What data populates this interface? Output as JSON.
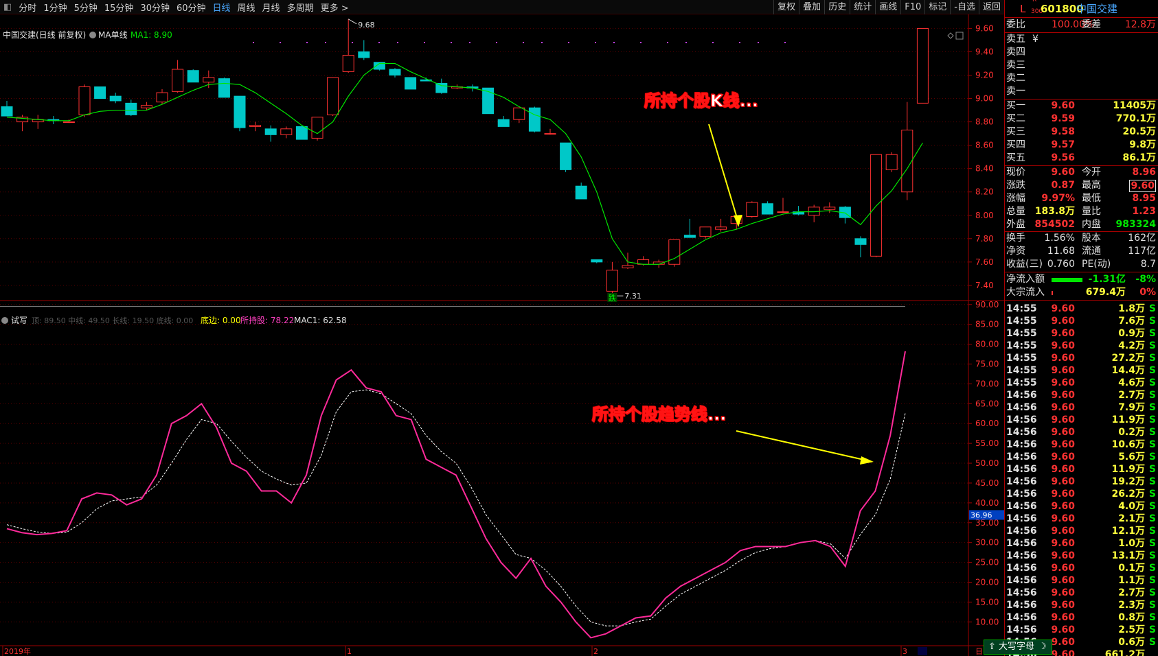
{
  "toolbar": {
    "items": [
      "分时",
      "1分钟",
      "5分钟",
      "15分钟",
      "30分钟",
      "60分钟",
      "日线",
      "周线",
      "月线",
      "多周期",
      "更多 >"
    ],
    "active_index": 6,
    "right_items": [
      "复权",
      "叠加",
      "历史",
      "统计",
      "画线",
      "F10",
      "标记",
      "-自选",
      "返回"
    ]
  },
  "stock_header": {
    "marker": "L",
    "code": "601800",
    "name": "中国交建",
    "sup": "R",
    "sub": "300"
  },
  "upper_chart": {
    "title": "中国交建(日线 前复权)",
    "indicator_label": "MA单线",
    "ma_label": "MA1: 8.90",
    "high_label": "9.68",
    "low_label": "7.31",
    "fall_tag": "跌",
    "annotation": "所持个股K线..."
  },
  "lower_chart": {
    "name": "试写",
    "legend_dim": "顶: 89.50  中线: 49.50  长线: 19.50  底线: 0.00",
    "legend_bottom": "底边: 0.00",
    "legend_pos": "所持股: 78.22",
    "legend_mac": "MAC1: 62.58",
    "annotation": "所持个股趋势线...",
    "current_tag": "36.96"
  },
  "date_axis": {
    "labels": [
      "2019年",
      "1",
      "2",
      "3"
    ],
    "right_label": "日"
  },
  "colors": {
    "up": "#ff3232",
    "down": "#00c8c8",
    "ma": "#00e600",
    "trend": "#ff2a9a",
    "mac": "#ffffff",
    "axis": "#a00000"
  },
  "chart_data": [
    {
      "type": "candlestick",
      "title": "中国交建(日线 前复权)",
      "y_ticks": [
        "9.60",
        "9.40",
        "9.20",
        "9.00",
        "8.80",
        "8.60",
        "8.40",
        "8.20",
        "8.00",
        "7.80",
        "7.60",
        "7.40"
      ],
      "ylim": [
        7.27,
        9.72
      ],
      "ohlc": [
        [
          8.93,
          8.98,
          8.85,
          8.85
        ],
        [
          8.8,
          8.86,
          8.72,
          8.84
        ],
        [
          8.8,
          8.86,
          8.74,
          8.82
        ],
        [
          8.82,
          8.85,
          8.78,
          8.81
        ],
        [
          8.8,
          8.82,
          8.79,
          8.8
        ],
        [
          8.86,
          9.12,
          8.84,
          9.1
        ],
        [
          9.1,
          9.1,
          9.0,
          9.0
        ],
        [
          9.02,
          9.05,
          8.96,
          8.98
        ],
        [
          8.96,
          8.99,
          8.85,
          8.86
        ],
        [
          8.92,
          8.97,
          8.9,
          8.94
        ],
        [
          8.97,
          9.08,
          8.95,
          9.05
        ],
        [
          9.06,
          9.33,
          9.05,
          9.25
        ],
        [
          9.24,
          9.25,
          9.14,
          9.14
        ],
        [
          9.14,
          9.24,
          9.09,
          9.18
        ],
        [
          9.17,
          9.18,
          9.01,
          9.01
        ],
        [
          9.02,
          9.02,
          8.72,
          8.75
        ],
        [
          8.76,
          8.8,
          8.72,
          8.77
        ],
        [
          8.74,
          8.77,
          8.63,
          8.69
        ],
        [
          8.69,
          8.76,
          8.66,
          8.74
        ],
        [
          8.76,
          8.76,
          8.65,
          8.65
        ],
        [
          8.66,
          8.84,
          8.64,
          8.84
        ],
        [
          8.86,
          9.18,
          8.85,
          9.18
        ],
        [
          9.23,
          9.68,
          9.22,
          9.37
        ],
        [
          9.4,
          9.5,
          9.33,
          9.35
        ],
        [
          9.31,
          9.31,
          9.24,
          9.25
        ],
        [
          9.25,
          9.26,
          9.18,
          9.2
        ],
        [
          9.18,
          9.18,
          9.08,
          9.08
        ],
        [
          9.16,
          9.18,
          9.15,
          9.15
        ],
        [
          9.13,
          9.17,
          9.04,
          9.05
        ],
        [
          9.09,
          9.12,
          9.08,
          9.1
        ],
        [
          9.1,
          9.12,
          9.06,
          9.09
        ],
        [
          9.09,
          9.09,
          8.87,
          8.87
        ],
        [
          8.82,
          8.85,
          8.77,
          8.76
        ],
        [
          8.82,
          8.92,
          8.79,
          8.92
        ],
        [
          8.92,
          8.93,
          8.71,
          8.72
        ],
        [
          8.7,
          8.74,
          8.69,
          8.7
        ],
        [
          8.62,
          8.62,
          8.37,
          8.39
        ],
        [
          8.25,
          8.28,
          8.16,
          8.14
        ],
        [
          7.62,
          7.62,
          7.59,
          7.6
        ],
        [
          7.35,
          7.6,
          7.31,
          7.53
        ],
        [
          7.55,
          7.68,
          7.54,
          7.57
        ],
        [
          7.58,
          7.65,
          7.57,
          7.62
        ],
        [
          7.58,
          7.62,
          7.55,
          7.6
        ],
        [
          7.58,
          7.75,
          7.56,
          7.79
        ],
        [
          7.83,
          7.97,
          7.83,
          7.81
        ],
        [
          7.82,
          7.88,
          7.8,
          7.9
        ],
        [
          7.88,
          7.97,
          7.86,
          7.9
        ],
        [
          7.93,
          7.96,
          7.88,
          7.99
        ],
        [
          7.99,
          8.12,
          7.98,
          8.11
        ],
        [
          8.1,
          8.12,
          8.03,
          8.01
        ],
        [
          8.03,
          8.15,
          8.02,
          8.03
        ],
        [
          8.03,
          8.08,
          8.0,
          8.01
        ],
        [
          8.0,
          8.09,
          7.94,
          8.07
        ],
        [
          8.05,
          8.11,
          8.02,
          8.07
        ],
        [
          8.07,
          8.08,
          7.93,
          7.98
        ],
        [
          7.8,
          7.82,
          7.64,
          7.75
        ],
        [
          7.65,
          8.52,
          7.64,
          8.52
        ],
        [
          8.39,
          8.54,
          8.37,
          8.52
        ],
        [
          8.2,
          8.97,
          8.13,
          8.73
        ],
        [
          8.96,
          9.6,
          8.96,
          9.6
        ]
      ],
      "ma": [
        8.84,
        8.83,
        8.82,
        8.81,
        8.81,
        8.86,
        8.89,
        8.9,
        8.9,
        8.9,
        8.95,
        9.01,
        9.07,
        9.12,
        9.13,
        9.12,
        9.05,
        8.96,
        8.87,
        8.77,
        8.7,
        8.8,
        9.02,
        9.2,
        9.3,
        9.3,
        9.23,
        9.17,
        9.11,
        9.1,
        9.09,
        9.06,
        9.01,
        8.93,
        8.86,
        8.82,
        8.7,
        8.5,
        8.2,
        7.8,
        7.6,
        7.58,
        7.58,
        7.63,
        7.71,
        7.79,
        7.85,
        7.88,
        7.93,
        7.97,
        8.01,
        8.03,
        8.03,
        8.04,
        8.02,
        7.92,
        8.08,
        8.21,
        8.4,
        8.62
      ]
    },
    {
      "type": "line",
      "y_ticks": [
        "90.00",
        "85.00",
        "80.00",
        "75.00",
        "70.00",
        "65.00",
        "60.00",
        "55.00",
        "50.00",
        "45.00",
        "40.00",
        "35.00",
        "30.00",
        "25.00",
        "20.00",
        "15.00",
        "10.00"
      ],
      "ylim": [
        4.0,
        91.0
      ],
      "series": [
        {
          "name": "所持股",
          "values": [
            33.5,
            32.5,
            32,
            32.3,
            33,
            41,
            42.5,
            42,
            39.5,
            41,
            47,
            60,
            62,
            65,
            59,
            50,
            48,
            43,
            43,
            40,
            47,
            62,
            71,
            73.5,
            69,
            68,
            62,
            61,
            51,
            49,
            47,
            39,
            31,
            25,
            21,
            26,
            19,
            15,
            10,
            6,
            7,
            9,
            11,
            11.5,
            16,
            19,
            21,
            23,
            25,
            28,
            29,
            29,
            29,
            30,
            30.5,
            29,
            24,
            38,
            43,
            57,
            78.22
          ]
        },
        {
          "name": "MAC1",
          "values": [
            34.5,
            33.5,
            32.7,
            32.3,
            32.6,
            35,
            38.5,
            40.5,
            41,
            41.5,
            44.5,
            50,
            56,
            61,
            60,
            55.5,
            51.5,
            48,
            46,
            44.5,
            45,
            52,
            63,
            68,
            68.5,
            67.5,
            65,
            62.5,
            57,
            53,
            50,
            44,
            37,
            32,
            27,
            26,
            23,
            19,
            14,
            10,
            9,
            9,
            10,
            10.7,
            14,
            17,
            19,
            21,
            23,
            25.5,
            27.5,
            28.5,
            29,
            30,
            30.5,
            29.7,
            26,
            32,
            37,
            46,
            62.58
          ]
        }
      ]
    }
  ],
  "side_panel": {
    "weibi": {
      "label": "委比",
      "value": "100.00%",
      "label2": "委差",
      "value2": "12.8万"
    },
    "sell": [
      {
        "label": "卖五",
        "price": "",
        "vol": "",
        "mark": "¥"
      },
      {
        "label": "卖四",
        "price": "",
        "vol": ""
      },
      {
        "label": "卖三",
        "price": "",
        "vol": ""
      },
      {
        "label": "卖二",
        "price": "",
        "vol": ""
      },
      {
        "label": "卖一",
        "price": "",
        "vol": ""
      }
    ],
    "buy": [
      {
        "label": "买一",
        "price": "9.60",
        "vol": "11405万"
      },
      {
        "label": "买二",
        "price": "9.59",
        "vol": "770.1万"
      },
      {
        "label": "买三",
        "price": "9.58",
        "vol": "20.5万"
      },
      {
        "label": "买四",
        "price": "9.57",
        "vol": "9.8万"
      },
      {
        "label": "买五",
        "price": "9.56",
        "vol": "86.1万"
      }
    ],
    "quote": [
      {
        "l1": "现价",
        "v1": "9.60",
        "l2": "今开",
        "v2": "8.96",
        "c1": "red",
        "c2": "red"
      },
      {
        "l1": "涨跌",
        "v1": "0.87",
        "l2": "最高",
        "v2": "9.60",
        "c1": "red",
        "c2": "red"
      },
      {
        "l1": "涨幅",
        "v1": "9.97%",
        "l2": "最低",
        "v2": "8.95",
        "c1": "red",
        "c2": "red"
      },
      {
        "l1": "总量",
        "v1": "183.8万",
        "l2": "量比",
        "v2": "1.23",
        "c1": "yellow",
        "c2": "red"
      },
      {
        "l1": "外盘",
        "v1": "854502",
        "l2": "内盘",
        "v2": "983324",
        "c1": "red",
        "c2": "green"
      }
    ],
    "stats": [
      {
        "l1": "换手",
        "v1": "1.56%",
        "l2": "股本",
        "v2": "162亿"
      },
      {
        "l1": "净资",
        "v1": "11.68",
        "l2": "流通",
        "v2": "117亿"
      },
      {
        "l1": "收益(三)",
        "v1": "0.760",
        "l2": "PE(动)",
        "v2": "8.7"
      }
    ],
    "flows": [
      {
        "label": "净流入额",
        "value": "-1.31亿",
        "pct": "-8%"
      },
      {
        "label": "大宗流入",
        "value": "679.4万",
        "pct": "0%"
      }
    ],
    "ticks": [
      {
        "t": "14:55",
        "p": "9.60",
        "v": "1.8万",
        "s": "S"
      },
      {
        "t": "14:55",
        "p": "9.60",
        "v": "7.6万",
        "s": "S"
      },
      {
        "t": "14:55",
        "p": "9.60",
        "v": "0.9万",
        "s": "S"
      },
      {
        "t": "14:55",
        "p": "9.60",
        "v": "4.2万",
        "s": "S"
      },
      {
        "t": "14:55",
        "p": "9.60",
        "v": "27.2万",
        "s": "S"
      },
      {
        "t": "14:55",
        "p": "9.60",
        "v": "14.4万",
        "s": "S"
      },
      {
        "t": "14:55",
        "p": "9.60",
        "v": "4.6万",
        "s": "S"
      },
      {
        "t": "14:56",
        "p": "9.60",
        "v": "2.7万",
        "s": "S"
      },
      {
        "t": "14:56",
        "p": "9.60",
        "v": "7.9万",
        "s": "S"
      },
      {
        "t": "14:56",
        "p": "9.60",
        "v": "11.9万",
        "s": "S"
      },
      {
        "t": "14:56",
        "p": "9.60",
        "v": "0.2万",
        "s": "S"
      },
      {
        "t": "14:56",
        "p": "9.60",
        "v": "10.6万",
        "s": "S"
      },
      {
        "t": "14:56",
        "p": "9.60",
        "v": "5.6万",
        "s": "S"
      },
      {
        "t": "14:56",
        "p": "9.60",
        "v": "11.9万",
        "s": "S"
      },
      {
        "t": "14:56",
        "p": "9.60",
        "v": "19.2万",
        "s": "S"
      },
      {
        "t": "14:56",
        "p": "9.60",
        "v": "26.2万",
        "s": "S"
      },
      {
        "t": "14:56",
        "p": "9.60",
        "v": "4.0万",
        "s": "S"
      },
      {
        "t": "14:56",
        "p": "9.60",
        "v": "2.1万",
        "s": "S"
      },
      {
        "t": "14:56",
        "p": "9.60",
        "v": "12.1万",
        "s": "S"
      },
      {
        "t": "14:56",
        "p": "9.60",
        "v": "1.0万",
        "s": "S"
      },
      {
        "t": "14:56",
        "p": "9.60",
        "v": "13.1万",
        "s": "S"
      },
      {
        "t": "14:56",
        "p": "9.60",
        "v": "0.1万",
        "s": "S"
      },
      {
        "t": "14:56",
        "p": "9.60",
        "v": "1.1万",
        "s": "S"
      },
      {
        "t": "14:56",
        "p": "9.60",
        "v": "2.7万",
        "s": "S"
      },
      {
        "t": "14:56",
        "p": "9.60",
        "v": "2.3万",
        "s": "S"
      },
      {
        "t": "14:56",
        "p": "9.60",
        "v": "0.8万",
        "s": "S"
      },
      {
        "t": "14:56",
        "p": "9.60",
        "v": "2.5万",
        "s": "S"
      },
      {
        "t": "14:56",
        "p": "9.60",
        "v": "0.6万",
        "s": "S"
      },
      {
        "t": "14:56",
        "p": "9.60",
        "v": "661.2万",
        "s": ""
      }
    ],
    "ime_label": "大写字母"
  }
}
